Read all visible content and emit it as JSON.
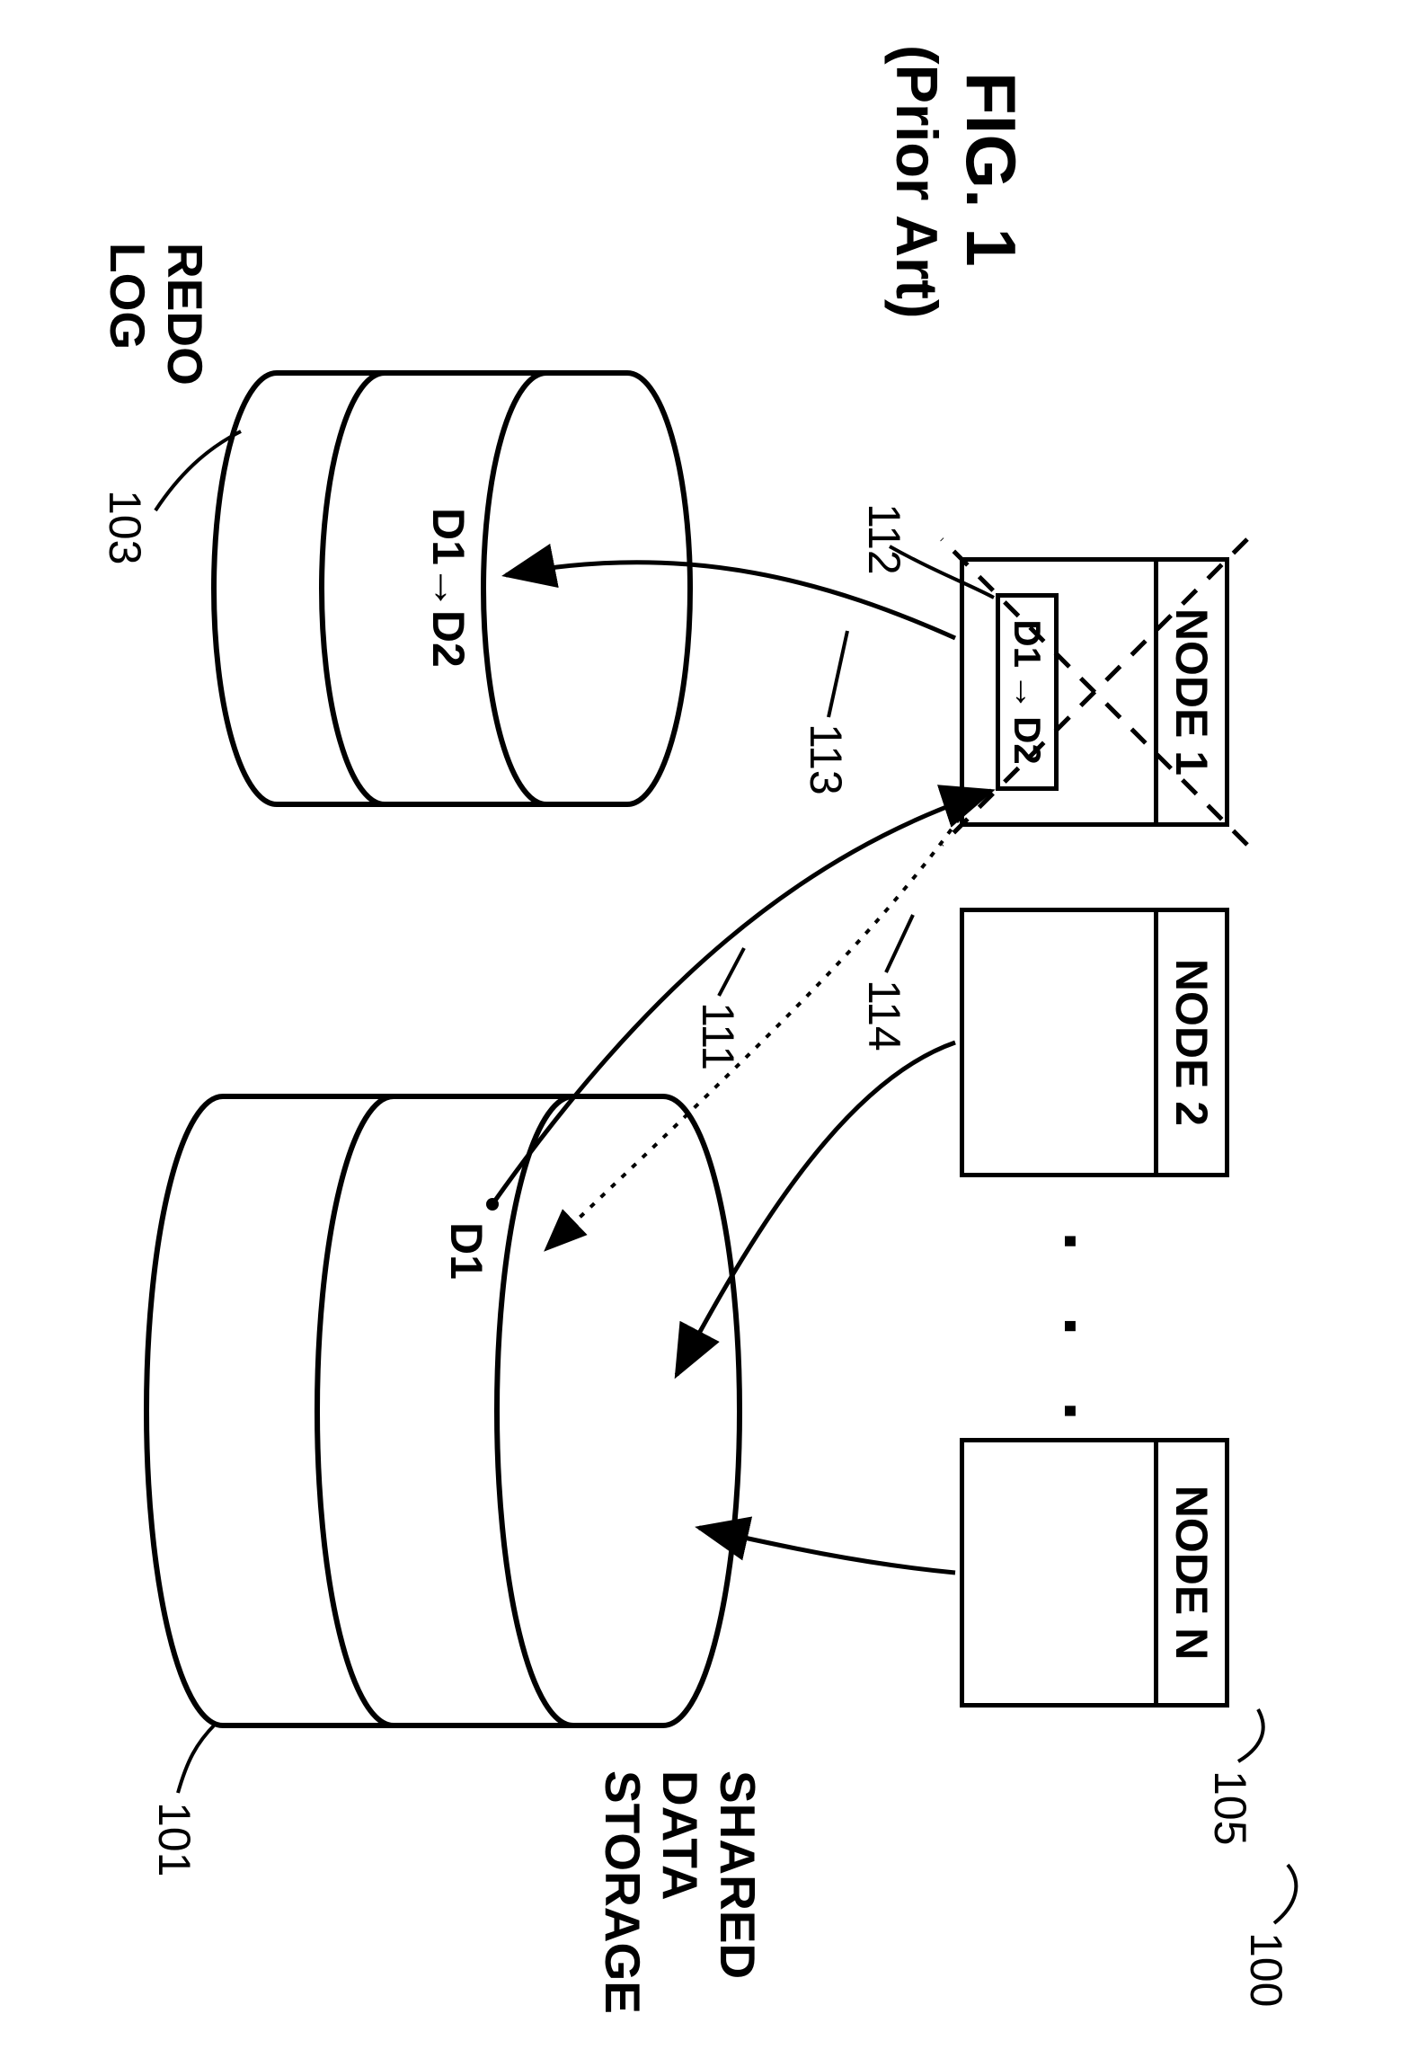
{
  "figure": {
    "title": "FIG. 1",
    "subtitle": "(Prior Art)"
  },
  "nodes": {
    "n1": "NODE 1",
    "n2": "NODE 2",
    "nn": "NODE N",
    "ellipsis": ". . ."
  },
  "node1_data": {
    "d1": "D1",
    "arrow": "→",
    "d2": "D2"
  },
  "cylinders": {
    "redo_title": "REDO\nLOG",
    "redo_content": "D1→D2",
    "shared_title": "SHARED\nDATA\nSTORAGE",
    "shared_content": "D1"
  },
  "refs": {
    "r100": "100",
    "r101": "101",
    "r103": "103",
    "r105": "105",
    "r111": "111",
    "r112": "112",
    "r113": "113",
    "r114": "114"
  }
}
